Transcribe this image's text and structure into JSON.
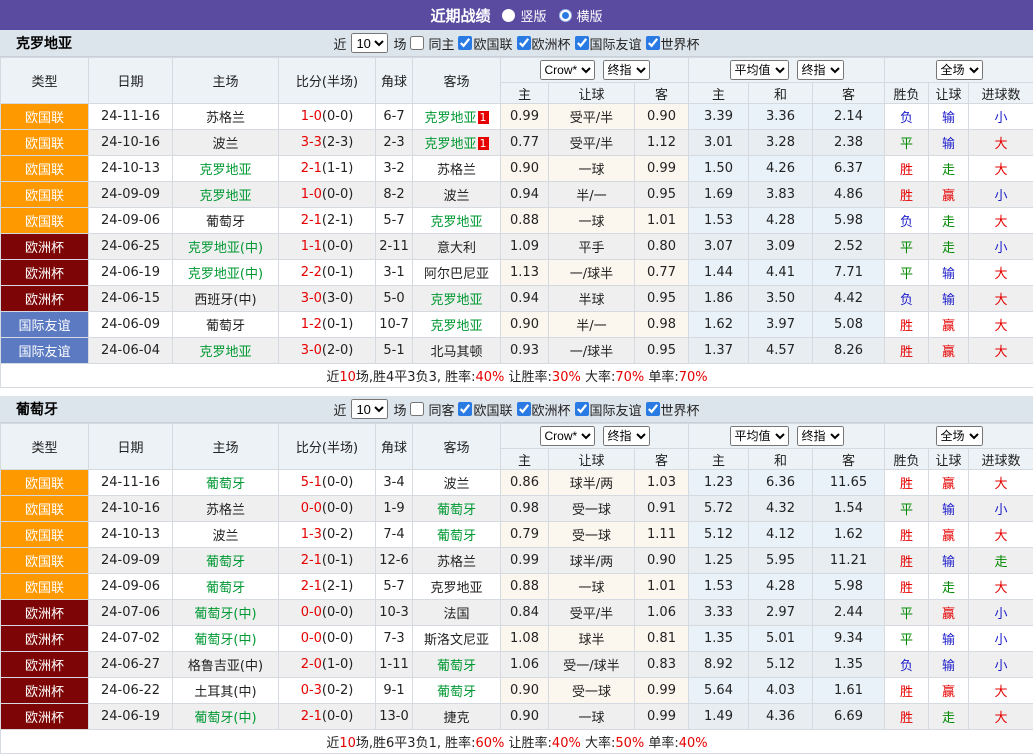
{
  "title_bar": {
    "title": "近期战绩",
    "options": [
      {
        "label": "竖版",
        "selected": false
      },
      {
        "label": "横版",
        "selected": true
      }
    ]
  },
  "filter": {
    "near": "近",
    "count": "10",
    "games": "场",
    "leagues": [
      "欧国联",
      "欧洲杯",
      "国际友谊",
      "世界杯"
    ]
  },
  "header": {
    "type": "类型",
    "date": "日期",
    "home": "主场",
    "score": "比分(半场)",
    "corner": "角球",
    "away": "客场",
    "odds_select1": "Crow*",
    "odds_select2": "终指",
    "avg_select1": "平均值",
    "avg_select2": "终指",
    "result_select": "全场",
    "home_s": "主",
    "handicap": "让球",
    "away_s": "客",
    "draw": "和",
    "wdl": "胜负",
    "goals": "进球数"
  },
  "type_colors": {
    "欧国联": "#ff9900",
    "欧洲杯": "#7d0505",
    "国际友谊": "#5b7ac1"
  },
  "result_colors": {
    "胜": "#e60000",
    "平": "#008800",
    "负": "#2020cc",
    "赢": "#e60000",
    "走": "#008800",
    "输": "#2020cc",
    "大": "#e60000",
    "小": "#2020cc"
  },
  "sections": [
    {
      "team": "克罗地亚",
      "same_label": "同主",
      "rows": [
        {
          "type": "欧国联",
          "date": "24-11-16",
          "home": "苏格兰",
          "home_hl": false,
          "score": "1-0",
          "half": "(0-0)",
          "corner": "6-7",
          "away": "克罗地亚",
          "away_hl": true,
          "away_badge": "1",
          "odds": [
            "0.99",
            "受平/半",
            "0.90"
          ],
          "avg": [
            "3.39",
            "3.36",
            "2.14"
          ],
          "results": [
            "负",
            "输",
            "小"
          ]
        },
        {
          "type": "欧国联",
          "date": "24-10-16",
          "home": "波兰",
          "home_hl": false,
          "score": "3-3",
          "half": "(2-3)",
          "corner": "2-3",
          "away": "克罗地亚",
          "away_hl": true,
          "away_badge": "1",
          "odds": [
            "0.77",
            "受平/半",
            "1.12"
          ],
          "avg": [
            "3.01",
            "3.28",
            "2.38"
          ],
          "results": [
            "平",
            "输",
            "大"
          ]
        },
        {
          "type": "欧国联",
          "date": "24-10-13",
          "home": "克罗地亚",
          "home_hl": true,
          "score": "2-1",
          "half": "(1-1)",
          "corner": "3-2",
          "away": "苏格兰",
          "away_hl": false,
          "odds": [
            "0.90",
            "一球",
            "0.99"
          ],
          "avg": [
            "1.50",
            "4.26",
            "6.37"
          ],
          "results": [
            "胜",
            "走",
            "大"
          ]
        },
        {
          "type": "欧国联",
          "date": "24-09-09",
          "home": "克罗地亚",
          "home_hl": true,
          "score": "1-0",
          "half": "(0-0)",
          "corner": "8-2",
          "away": "波兰",
          "away_hl": false,
          "odds": [
            "0.94",
            "半/一",
            "0.95"
          ],
          "avg": [
            "1.69",
            "3.83",
            "4.86"
          ],
          "results": [
            "胜",
            "赢",
            "小"
          ]
        },
        {
          "type": "欧国联",
          "date": "24-09-06",
          "home": "葡萄牙",
          "home_hl": false,
          "score": "2-1",
          "half": "(2-1)",
          "corner": "5-7",
          "away": "克罗地亚",
          "away_hl": true,
          "odds": [
            "0.88",
            "一球",
            "1.01"
          ],
          "avg": [
            "1.53",
            "4.28",
            "5.98"
          ],
          "results": [
            "负",
            "走",
            "大"
          ]
        },
        {
          "type": "欧洲杯",
          "date": "24-06-25",
          "home": "克罗地亚(中)",
          "home_hl": true,
          "score": "1-1",
          "half": "(0-0)",
          "corner": "2-11",
          "away": "意大利",
          "away_hl": false,
          "odds": [
            "1.09",
            "平手",
            "0.80"
          ],
          "avg": [
            "3.07",
            "3.09",
            "2.52"
          ],
          "results": [
            "平",
            "走",
            "小"
          ]
        },
        {
          "type": "欧洲杯",
          "date": "24-06-19",
          "home": "克罗地亚(中)",
          "home_hl": true,
          "score": "2-2",
          "half": "(0-1)",
          "corner": "3-1",
          "away": "阿尔巴尼亚",
          "away_hl": false,
          "odds": [
            "1.13",
            "一/球半",
            "0.77"
          ],
          "avg": [
            "1.44",
            "4.41",
            "7.71"
          ],
          "results": [
            "平",
            "输",
            "大"
          ]
        },
        {
          "type": "欧洲杯",
          "date": "24-06-15",
          "home": "西班牙(中)",
          "home_hl": false,
          "score": "3-0",
          "half": "(3-0)",
          "corner": "5-0",
          "away": "克罗地亚",
          "away_hl": true,
          "odds": [
            "0.94",
            "半球",
            "0.95"
          ],
          "avg": [
            "1.86",
            "3.50",
            "4.42"
          ],
          "results": [
            "负",
            "输",
            "大"
          ]
        },
        {
          "type": "国际友谊",
          "date": "24-06-09",
          "home": "葡萄牙",
          "home_hl": false,
          "score": "1-2",
          "half": "(0-1)",
          "corner": "10-7",
          "away": "克罗地亚",
          "away_hl": true,
          "odds": [
            "0.90",
            "半/一",
            "0.98"
          ],
          "avg": [
            "1.62",
            "3.97",
            "5.08"
          ],
          "results": [
            "胜",
            "赢",
            "大"
          ]
        },
        {
          "type": "国际友谊",
          "date": "24-06-04",
          "home": "克罗地亚",
          "home_hl": true,
          "score": "3-0",
          "half": "(2-0)",
          "corner": "5-1",
          "away": "北马其顿",
          "away_hl": false,
          "odds": [
            "0.93",
            "一/球半",
            "0.95"
          ],
          "avg": [
            "1.37",
            "4.57",
            "8.26"
          ],
          "results": [
            "胜",
            "赢",
            "大"
          ]
        }
      ],
      "summary": [
        {
          "t": "近"
        },
        {
          "t": "10",
          "red": true
        },
        {
          "t": "场,胜4平3负3, 胜率:"
        },
        {
          "t": "40%",
          "red": true
        },
        {
          "t": " 让胜率:"
        },
        {
          "t": "30%",
          "red": true
        },
        {
          "t": " 大率:"
        },
        {
          "t": "70%",
          "red": true
        },
        {
          "t": " 单率:"
        },
        {
          "t": "70%",
          "red": true
        }
      ]
    },
    {
      "team": "葡萄牙",
      "same_label": "同客",
      "rows": [
        {
          "type": "欧国联",
          "date": "24-11-16",
          "home": "葡萄牙",
          "home_hl": true,
          "score": "5-1",
          "half": "(0-0)",
          "corner": "3-4",
          "away": "波兰",
          "away_hl": false,
          "odds": [
            "0.86",
            "球半/两",
            "1.03"
          ],
          "avg": [
            "1.23",
            "6.36",
            "11.65"
          ],
          "results": [
            "胜",
            "赢",
            "大"
          ]
        },
        {
          "type": "欧国联",
          "date": "24-10-16",
          "home": "苏格兰",
          "home_hl": false,
          "score": "0-0",
          "half": "(0-0)",
          "corner": "1-9",
          "away": "葡萄牙",
          "away_hl": true,
          "odds": [
            "0.98",
            "受一球",
            "0.91"
          ],
          "avg": [
            "5.72",
            "4.32",
            "1.54"
          ],
          "results": [
            "平",
            "输",
            "小"
          ]
        },
        {
          "type": "欧国联",
          "date": "24-10-13",
          "home": "波兰",
          "home_hl": false,
          "score": "1-3",
          "half": "(0-2)",
          "corner": "7-4",
          "away": "葡萄牙",
          "away_hl": true,
          "odds": [
            "0.79",
            "受一球",
            "1.11"
          ],
          "avg": [
            "5.12",
            "4.12",
            "1.62"
          ],
          "results": [
            "胜",
            "赢",
            "大"
          ]
        },
        {
          "type": "欧国联",
          "date": "24-09-09",
          "home": "葡萄牙",
          "home_hl": true,
          "score": "2-1",
          "half": "(0-1)",
          "corner": "12-6",
          "away": "苏格兰",
          "away_hl": false,
          "odds": [
            "0.99",
            "球半/两",
            "0.90"
          ],
          "avg": [
            "1.25",
            "5.95",
            "11.21"
          ],
          "results": [
            "胜",
            "输",
            "走"
          ]
        },
        {
          "type": "欧国联",
          "date": "24-09-06",
          "home": "葡萄牙",
          "home_hl": true,
          "score": "2-1",
          "half": "(2-1)",
          "corner": "5-7",
          "away": "克罗地亚",
          "away_hl": false,
          "odds": [
            "0.88",
            "一球",
            "1.01"
          ],
          "avg": [
            "1.53",
            "4.28",
            "5.98"
          ],
          "results": [
            "胜",
            "走",
            "大"
          ]
        },
        {
          "type": "欧洲杯",
          "date": "24-07-06",
          "home": "葡萄牙(中)",
          "home_hl": true,
          "score": "0-0",
          "half": "(0-0)",
          "corner": "10-3",
          "away": "法国",
          "away_hl": false,
          "odds": [
            "0.84",
            "受平/半",
            "1.06"
          ],
          "avg": [
            "3.33",
            "2.97",
            "2.44"
          ],
          "results": [
            "平",
            "赢",
            "小"
          ]
        },
        {
          "type": "欧洲杯",
          "date": "24-07-02",
          "home": "葡萄牙(中)",
          "home_hl": true,
          "score": "0-0",
          "half": "(0-0)",
          "corner": "7-3",
          "away": "斯洛文尼亚",
          "away_hl": false,
          "odds": [
            "1.08",
            "球半",
            "0.81"
          ],
          "avg": [
            "1.35",
            "5.01",
            "9.34"
          ],
          "results": [
            "平",
            "输",
            "小"
          ]
        },
        {
          "type": "欧洲杯",
          "date": "24-06-27",
          "home": "格鲁吉亚(中)",
          "home_hl": false,
          "score": "2-0",
          "half": "(1-0)",
          "corner": "1-11",
          "away": "葡萄牙",
          "away_hl": true,
          "odds": [
            "1.06",
            "受一/球半",
            "0.83"
          ],
          "avg": [
            "8.92",
            "5.12",
            "1.35"
          ],
          "results": [
            "负",
            "输",
            "小"
          ]
        },
        {
          "type": "欧洲杯",
          "date": "24-06-22",
          "home": "土耳其(中)",
          "home_hl": false,
          "score": "0-3",
          "half": "(0-2)",
          "corner": "9-1",
          "away": "葡萄牙",
          "away_hl": true,
          "odds": [
            "0.90",
            "受一球",
            "0.99"
          ],
          "avg": [
            "5.64",
            "4.03",
            "1.61"
          ],
          "results": [
            "胜",
            "赢",
            "大"
          ]
        },
        {
          "type": "欧洲杯",
          "date": "24-06-19",
          "home": "葡萄牙(中)",
          "home_hl": true,
          "score": "2-1",
          "half": "(0-0)",
          "corner": "13-0",
          "away": "捷克",
          "away_hl": false,
          "odds": [
            "0.90",
            "一球",
            "0.99"
          ],
          "avg": [
            "1.49",
            "4.36",
            "6.69"
          ],
          "results": [
            "胜",
            "走",
            "大"
          ]
        }
      ],
      "summary": [
        {
          "t": "近"
        },
        {
          "t": "10",
          "red": true
        },
        {
          "t": "场,胜6平3负1, 胜率:"
        },
        {
          "t": "60%",
          "red": true
        },
        {
          "t": " 让胜率:"
        },
        {
          "t": "40%",
          "red": true
        },
        {
          "t": " 大率:"
        },
        {
          "t": "50%",
          "red": true
        },
        {
          "t": " 单率:"
        },
        {
          "t": "40%",
          "red": true
        }
      ]
    }
  ]
}
